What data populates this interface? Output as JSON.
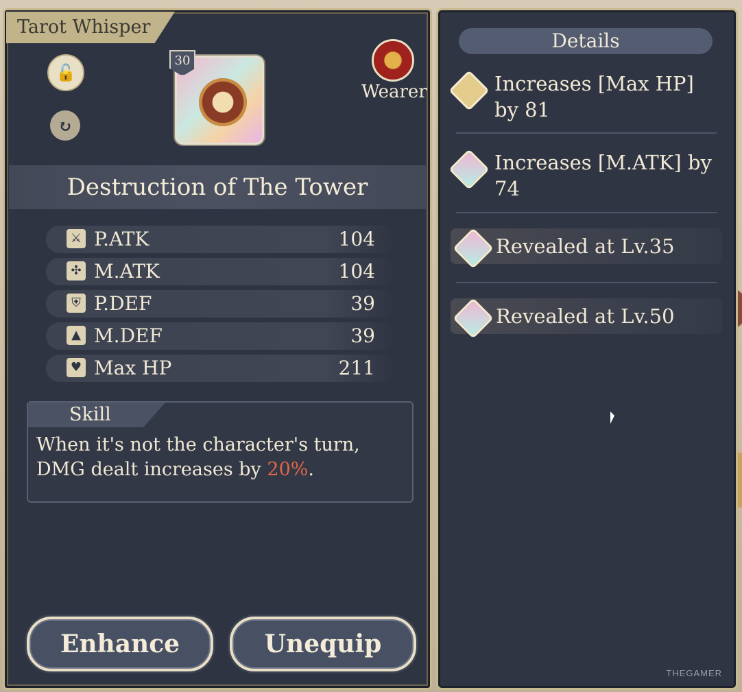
{
  "panel": {
    "title": "Tarot Whisper",
    "card_level": "30",
    "card_name": "Destruction of The Tower",
    "wearer_label": "Wearer"
  },
  "stats": [
    {
      "label": "P.ATK",
      "value": "104",
      "icon": "sword-icon"
    },
    {
      "label": "M.ATK",
      "value": "104",
      "icon": "staff-icon"
    },
    {
      "label": "P.DEF",
      "value": "39",
      "icon": "shield-icon"
    },
    {
      "label": "M.DEF",
      "value": "39",
      "icon": "wizard-hat-icon"
    },
    {
      "label": "Max HP",
      "value": "211",
      "icon": "heart-icon"
    }
  ],
  "skill": {
    "label": "Skill",
    "text_before": "When it's not the character's turn, DMG dealt increases by ",
    "highlight": "20%",
    "text_after": "."
  },
  "buttons": {
    "enhance": "Enhance",
    "unequip": "Unequip"
  },
  "details": {
    "header": "Details",
    "items": [
      {
        "text": "Increases [Max HP] by 81",
        "gem": "gold"
      },
      {
        "text": "Increases [M.ATK] by 74",
        "gem": "pastel"
      },
      {
        "text": "Revealed at Lv.35",
        "gem": "pastel"
      },
      {
        "text": "Revealed at Lv.50",
        "gem": "pastel"
      }
    ]
  },
  "watermark": "THEGAMER"
}
